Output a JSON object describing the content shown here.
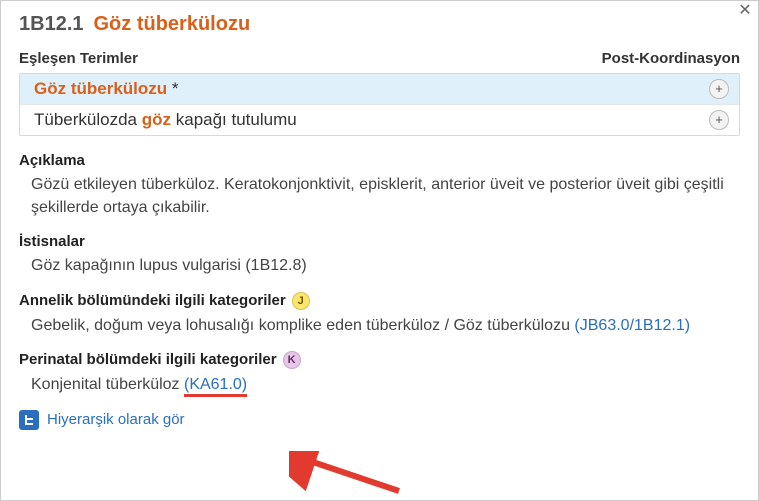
{
  "header": {
    "code": "1B12.1",
    "title": "Göz tüberkülozu"
  },
  "meta": {
    "matching_label": "Eşleşen Terimler",
    "postcoord_label": "Post-Koordinasyon"
  },
  "matches": [
    {
      "text_pre": "",
      "text_hl": "Göz tüberkülozu",
      "text_post": "  *",
      "selected": true,
      "full_hl": true
    },
    {
      "text_pre": "Tüberkülozda ",
      "text_hl": "göz",
      "text_post": " kapağı tutulumu",
      "selected": false,
      "full_hl": false
    }
  ],
  "sections": {
    "description": {
      "title": "Açıklama",
      "body": "Gözü etkileyen tüberküloz. Keratokonjonktivit, episklerit, anterior üveit ve posterior üveit gibi çeşitli şekillerde ortaya çıkabilir."
    },
    "exclusions": {
      "title": "İstisnalar",
      "body": "Göz kapağının lupus vulgarisi (1B12.8)"
    },
    "maternal": {
      "title": "Annelik bölümündeki ilgili kategoriler",
      "badge": "J",
      "body_pre": "Gebelik, doğum veya lohusalığı komplike eden tüberküloz / Göz tüberkülozu  ",
      "code_link": "(JB63.0/1B12.1)"
    },
    "perinatal": {
      "title": "Perinatal bölümdeki ilgili kategoriler",
      "badge": "K",
      "body_pre": "Konjenital tüberküloz  ",
      "code_link": "(KA61.0)"
    }
  },
  "footer": {
    "hierarchy_link": "Hiyerarşik olarak gör"
  },
  "icons": {
    "close": "✕",
    "plus": "+"
  }
}
